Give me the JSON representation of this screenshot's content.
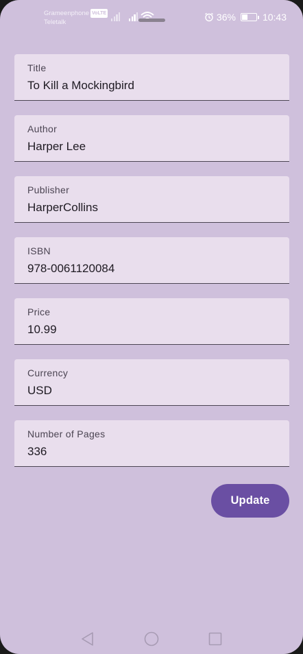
{
  "status_bar": {
    "carrier_1": "Grameenphone",
    "volte_label": "VoLTE",
    "carrier_2": "Teletalk",
    "battery_percent": "36%",
    "battery_level": 0.36,
    "time": "10:43",
    "icons": [
      "signal-icon",
      "wifi-icon",
      "alarm-icon",
      "battery-icon"
    ]
  },
  "form": {
    "fields": [
      {
        "label": "Title",
        "value": "To Kill a Mockingbird"
      },
      {
        "label": "Author",
        "value": "Harper Lee"
      },
      {
        "label": "Publisher",
        "value": "HarperCollins"
      },
      {
        "label": "ISBN",
        "value": "978-0061120084"
      },
      {
        "label": "Price",
        "value": "10.99"
      },
      {
        "label": "Currency",
        "value": "USD"
      },
      {
        "label": "Number of Pages",
        "value": "336"
      }
    ],
    "update_label": "Update"
  },
  "nav_bar": {
    "icons": [
      "back-icon",
      "home-icon",
      "recents-icon"
    ]
  },
  "colors": {
    "background": "#cfc0dc",
    "field_background": "#e9deed",
    "accent": "#6a4fa3",
    "text": "#1e1a22",
    "label": "#4b4452"
  }
}
